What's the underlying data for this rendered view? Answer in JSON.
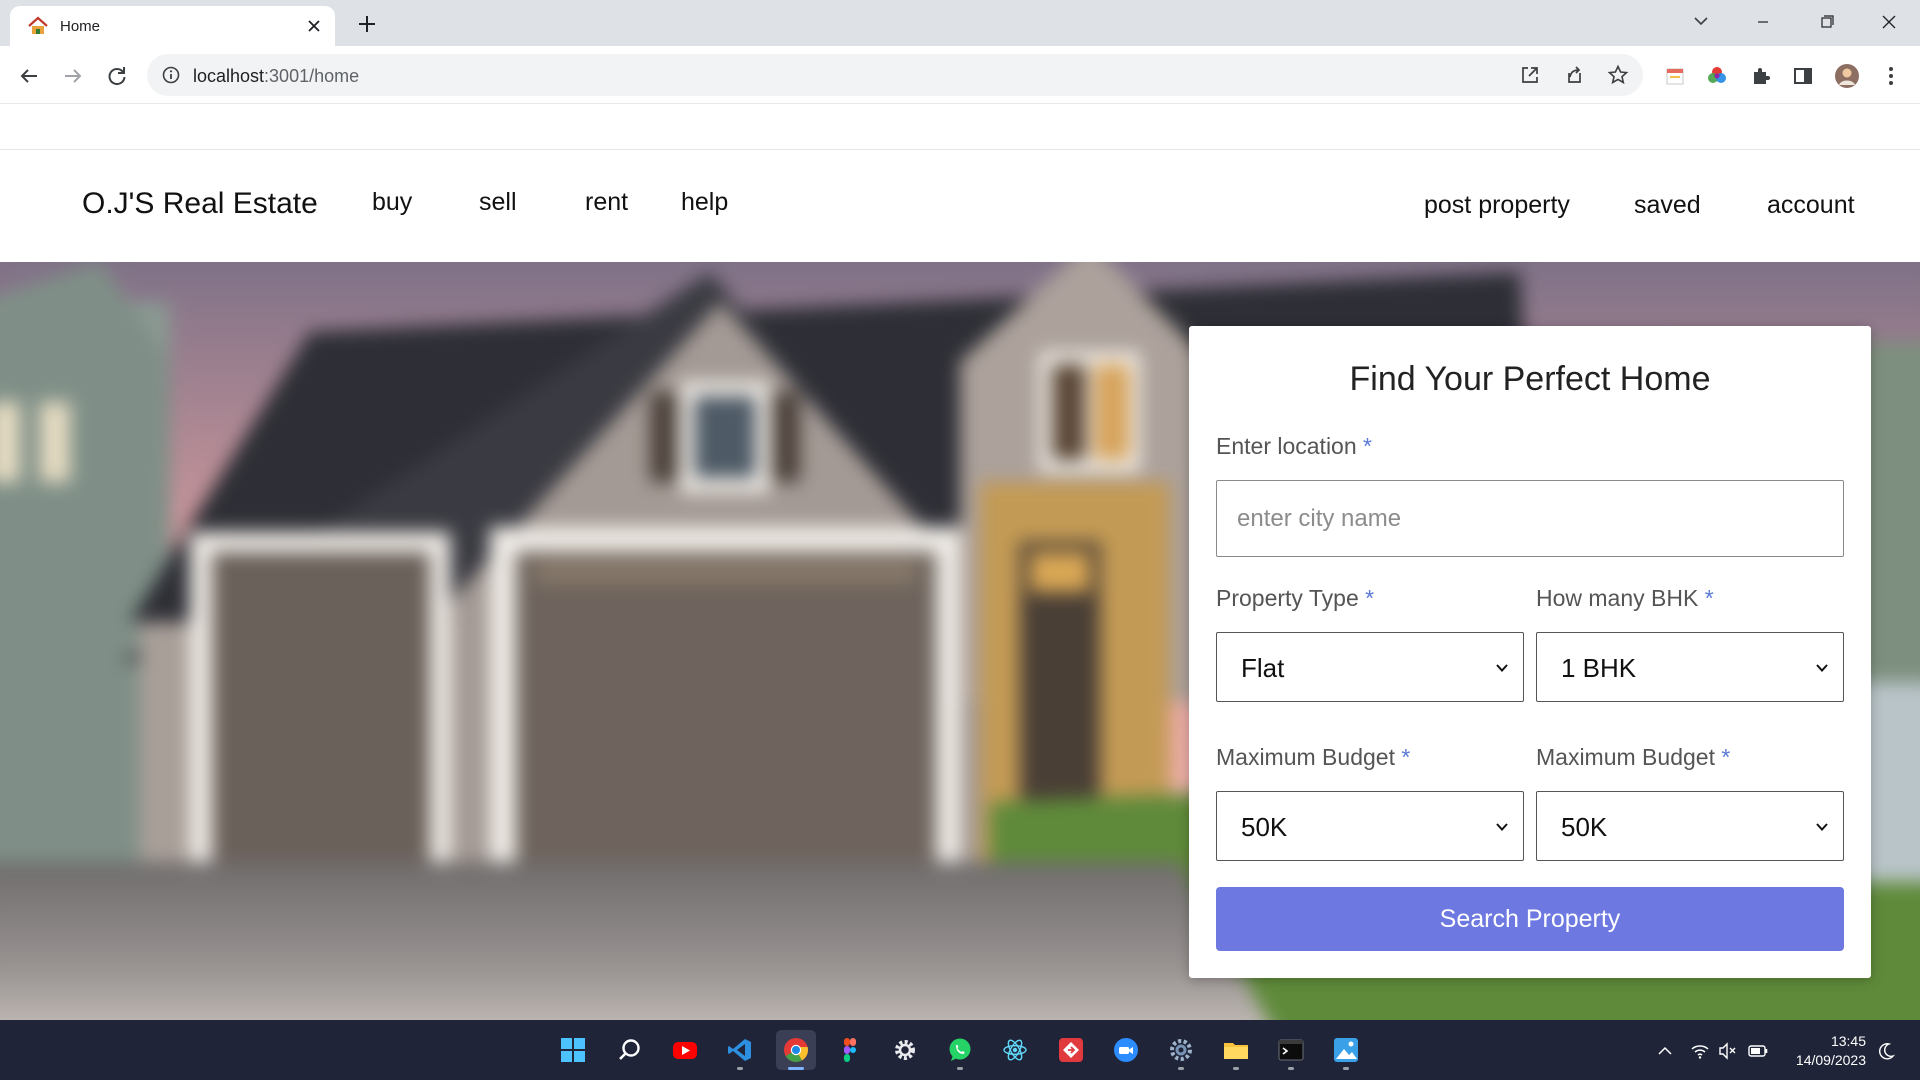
{
  "browser": {
    "tab_title": "Home",
    "url_host": "localhost",
    "url_rest": ":3001/home",
    "tab_favicon": "house-icon"
  },
  "site": {
    "brand": "O.J'S Real Estate",
    "nav_left": [
      "buy",
      "sell",
      "rent",
      "help"
    ],
    "nav_right": [
      "post property",
      "saved",
      "account"
    ]
  },
  "search_form": {
    "title": "Find Your Perfect Home",
    "location_label": "Enter location",
    "location_placeholder": "enter city name",
    "property_type_label": "Property Type",
    "property_type_value": "Flat",
    "bhk_label": "How many BHK",
    "bhk_value": "1 BHK",
    "budget_label_1": "Maximum Budget",
    "budget_value_1": "50K",
    "budget_label_2": "Maximum Budget",
    "budget_value_2": "50K",
    "required_mark": "*",
    "submit_label": "Search Property"
  },
  "taskbar": {
    "time": "13:45",
    "date": "14/09/2023",
    "apps": [
      "start",
      "search",
      "youtube",
      "vscode",
      "chrome",
      "figma",
      "settings",
      "whatsapp",
      "react",
      "git",
      "zoom",
      "settings",
      "file-explorer",
      "terminal",
      "photos"
    ]
  },
  "colors": {
    "accent": "#6d78e0",
    "required": "#5a7ad6",
    "taskbar": "#1f2438",
    "tabstrip": "#dee1e6"
  }
}
